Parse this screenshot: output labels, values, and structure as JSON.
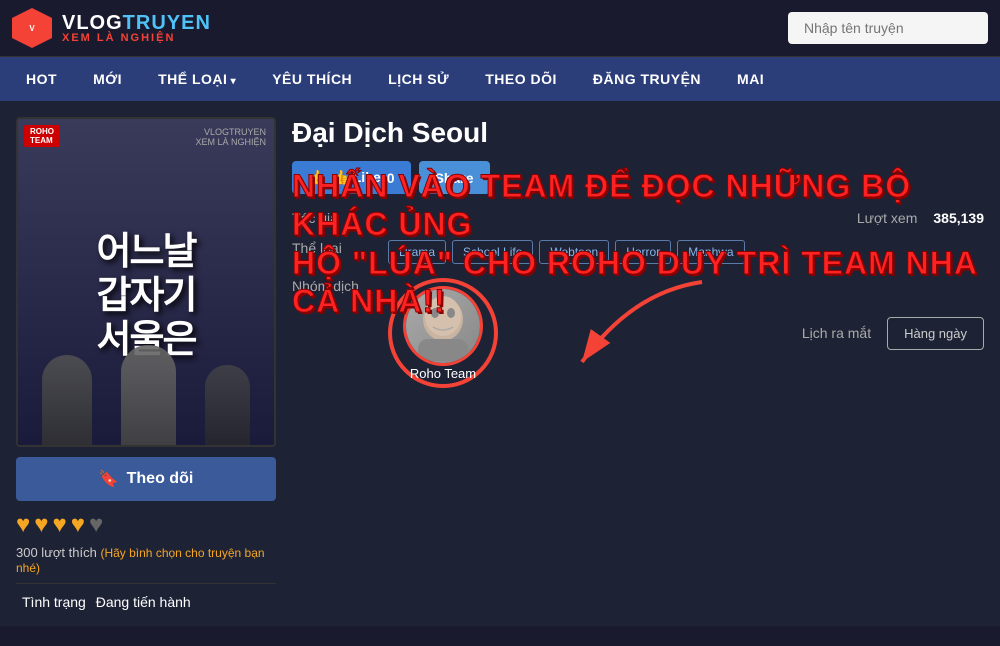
{
  "header": {
    "logo_main": "VLOGTRUYEN",
    "logo_sub": "XEM LÀ NGHIỆN",
    "search_placeholder": "Nhập tên truyện"
  },
  "nav": {
    "items": [
      {
        "label": "HOT",
        "has_arrow": false
      },
      {
        "label": "MỚI",
        "has_arrow": false
      },
      {
        "label": "THỂ LOẠI",
        "has_arrow": true
      },
      {
        "label": "YÊU THÍCH",
        "has_arrow": false
      },
      {
        "label": "LỊCH SỬ",
        "has_arrow": false
      },
      {
        "label": "THEO DÕI",
        "has_arrow": false
      },
      {
        "label": "ĐĂNG TRUYỆN",
        "has_arrow": false
      },
      {
        "label": "MAI",
        "has_arrow": false
      }
    ]
  },
  "manga": {
    "title": "Đại Dịch Seoul",
    "cover_title_kr": "어느날\n갑자기\n서울은",
    "cover_team": "ROHO\nTEAM",
    "like_label": "👍 Like",
    "like_count": "0",
    "share_label": "Share",
    "promo_line1": "NHẤN VÀO TEAM ĐỂ ĐỌC NHỮNG BỘ KHÁC ỦNG",
    "promo_line2": "HỘ \"LÚA\" CHO ROHO DUY TRÌ TEAM NHA CẢ NHÀ!!",
    "tac_gia_label": "Tác giả",
    "tac_gia_value": "",
    "luot_xem_label": "Lượt xem",
    "luot_xem_value": "385,139",
    "the_loai_label": "Thể loại",
    "genres": [
      "Drama",
      "School Life",
      "Webtoon",
      "Horror",
      "Manhwa"
    ],
    "nhom_dich_label": "Nhóm dịch",
    "lich_ra_mat_label": "Lịch ra mắt",
    "hang_ngay_label": "Hàng ngày",
    "translator_name": "Roho Team",
    "theo_doi_label": "Theo dõi",
    "rating_count": "300 lượt thích",
    "rating_hint": "(Hãy bình chọn cho truyện bạn nhé)",
    "tinh_trang_label": "Tình trạng",
    "tinh_trang_value": "Đang tiến hành",
    "hearts_filled": 4,
    "hearts_total": 5
  }
}
